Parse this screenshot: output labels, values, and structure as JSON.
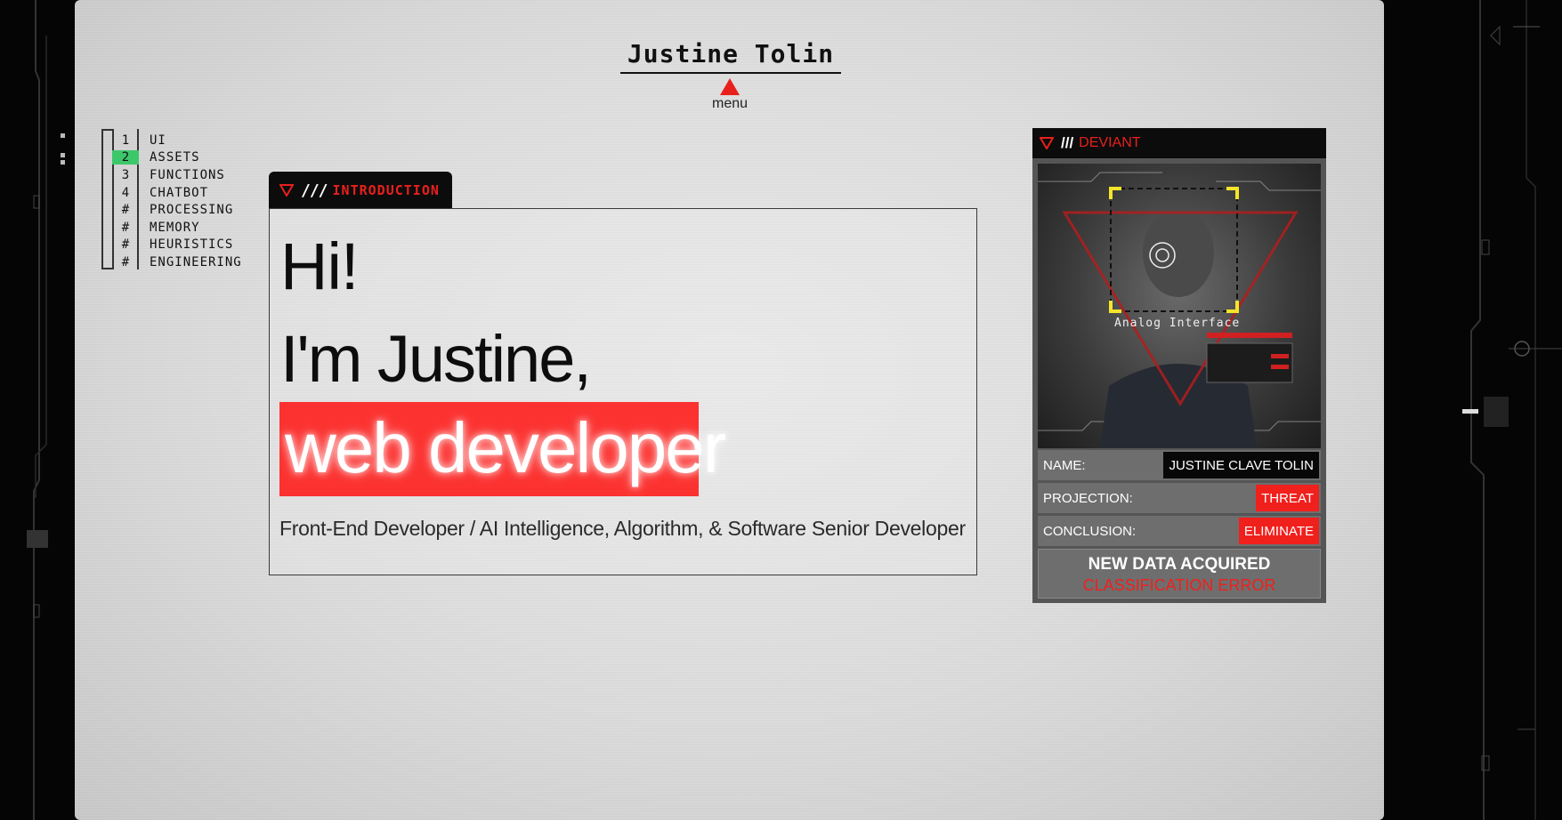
{
  "header": {
    "title": "Justine Tolin",
    "menu_label": "menu"
  },
  "nav": {
    "items": [
      {
        "num": "1",
        "label": "UI",
        "active": false
      },
      {
        "num": "2",
        "label": "ASSETS",
        "active": true
      },
      {
        "num": "3",
        "label": "FUNCTIONS",
        "active": false
      },
      {
        "num": "4",
        "label": "CHATBOT",
        "active": false
      },
      {
        "num": "#",
        "label": "PROCESSING",
        "active": false
      },
      {
        "num": "#",
        "label": "MEMORY",
        "active": false
      },
      {
        "num": "#",
        "label": "HEURISTICS",
        "active": false
      },
      {
        "num": "#",
        "label": "ENGINEERING",
        "active": false
      }
    ]
  },
  "intro": {
    "tab_slashes": "///",
    "tab_label": "INTRODUCTION",
    "greeting": "Hi!",
    "name_line": "I'm Justine,",
    "role": "web developer",
    "subtitle": "Front-End Developer / AI Intelligence, Algorithm, & Software Senior Developer"
  },
  "card": {
    "tab_slashes": "///",
    "tab_label": "DEVIANT",
    "photo_caption": "Analog Interface",
    "rows": [
      {
        "key": "NAME:",
        "value": "JUSTINE CLAVE TOLIN",
        "style": "dark"
      },
      {
        "key": "PROJECTION:",
        "value": "THREAT",
        "style": "red"
      },
      {
        "key": "CONCLUSION:",
        "value": "ELIMINATE",
        "style": "red"
      }
    ],
    "status_line1": "NEW DATA ACQUIRED",
    "status_line2": "CLASSIFICATION ERROR"
  },
  "colors": {
    "accent_red": "#e8201c",
    "active_green": "#3cc76b",
    "highlight_red": "#fb3230"
  },
  "icons": {
    "tab_marker": "triangle-down-outline-icon",
    "menu_toggle": "triangle-up-icon",
    "target_reticle": "crosshair-icon"
  }
}
